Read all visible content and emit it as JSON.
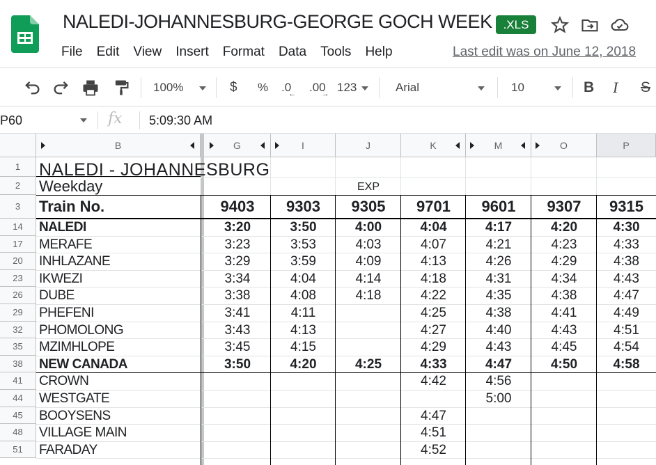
{
  "app": {
    "title": "NALEDI-JOHANNESBURG-GEORGE GOCH WEEK",
    "badge": ".XLS",
    "menus": [
      "File",
      "Edit",
      "View",
      "Insert",
      "Format",
      "Data",
      "Tools",
      "Help"
    ],
    "last_edit": "Last edit was on June 12, 2018"
  },
  "toolbar": {
    "zoom": "100%",
    "currency": "$",
    "percent": "%",
    "decrease_decimal": ".0",
    "increase_decimal": ".00",
    "number_format": "123",
    "font": "Arial",
    "font_size": "10",
    "bold": "B",
    "italic": "I",
    "strike": "S"
  },
  "formula_bar": {
    "name_box": "P60",
    "fx": "fx",
    "value": "5:09:30 AM"
  },
  "columns": [
    "B",
    "G",
    "I",
    "J",
    "K",
    "M",
    "O",
    "P"
  ],
  "sheet": {
    "title": "NALEDI - JOHANNESBURG",
    "weekday": "Weekday",
    "exp_label": "EXP",
    "train_label": "Train No.",
    "train_numbers": [
      "9403",
      "9303",
      "9305",
      "9701",
      "9601",
      "9307",
      "9315"
    ],
    "header_rows": [
      "1",
      "2",
      "3"
    ],
    "stations": [
      {
        "row": "14",
        "name": "NALEDI",
        "bold": true,
        "times": [
          "3:20",
          "3:50",
          "4:00",
          "4:04",
          "4:17",
          "4:20",
          "4:30"
        ]
      },
      {
        "row": "17",
        "name": "MERAFE",
        "bold": false,
        "times": [
          "3:23",
          "3:53",
          "4:03",
          "4:07",
          "4:21",
          "4:23",
          "4:33"
        ]
      },
      {
        "row": "20",
        "name": "INHLAZANE",
        "bold": false,
        "times": [
          "3:29",
          "3:59",
          "4:09",
          "4:13",
          "4:26",
          "4:29",
          "4:38"
        ]
      },
      {
        "row": "23",
        "name": "IKWEZI",
        "bold": false,
        "times": [
          "3:34",
          "4:04",
          "4:14",
          "4:18",
          "4:31",
          "4:34",
          "4:43"
        ]
      },
      {
        "row": "26",
        "name": "DUBE",
        "bold": false,
        "times": [
          "3:38",
          "4:08",
          "4:18",
          "4:22",
          "4:35",
          "4:38",
          "4:47"
        ]
      },
      {
        "row": "29",
        "name": "PHEFENI",
        "bold": false,
        "times": [
          "3:41",
          "4:11",
          "",
          "4:25",
          "4:38",
          "4:41",
          "4:49"
        ]
      },
      {
        "row": "32",
        "name": "PHOMOLONG",
        "bold": false,
        "times": [
          "3:43",
          "4:13",
          "",
          "4:27",
          "4:40",
          "4:43",
          "4:51"
        ]
      },
      {
        "row": "35",
        "name": "MZIMHLOPE",
        "bold": false,
        "times": [
          "3:45",
          "4:15",
          "",
          "4:29",
          "4:43",
          "4:45",
          "4:54"
        ]
      },
      {
        "row": "38",
        "name": "NEW CANADA",
        "bold": true,
        "times": [
          "3:50",
          "4:20",
          "4:25",
          "4:33",
          "4:47",
          "4:50",
          "4:58"
        ]
      },
      {
        "row": "41",
        "name": "CROWN",
        "bold": false,
        "times": [
          "",
          "",
          "",
          "4:42",
          "4:56",
          "",
          ""
        ]
      },
      {
        "row": "44",
        "name": "WESTGATE",
        "bold": false,
        "times": [
          "",
          "",
          "",
          "",
          "5:00",
          "",
          ""
        ]
      },
      {
        "row": "45",
        "name": "BOOYSENS",
        "bold": false,
        "times": [
          "",
          "",
          "",
          "4:47",
          "",
          "",
          ""
        ]
      },
      {
        "row": "48",
        "name": "VILLAGE MAIN",
        "bold": false,
        "times": [
          "",
          "",
          "",
          "4:51",
          "",
          "",
          ""
        ]
      },
      {
        "row": "51",
        "name": "FARADAY",
        "bold": false,
        "times": [
          "",
          "",
          "",
          "4:52",
          "",
          "",
          ""
        ]
      }
    ]
  },
  "colors": {
    "sheets_green": "#0f9d58",
    "xls_badge": "#188038",
    "header_bg": "#f8f9fa",
    "selected_col": "#e8eaed"
  }
}
